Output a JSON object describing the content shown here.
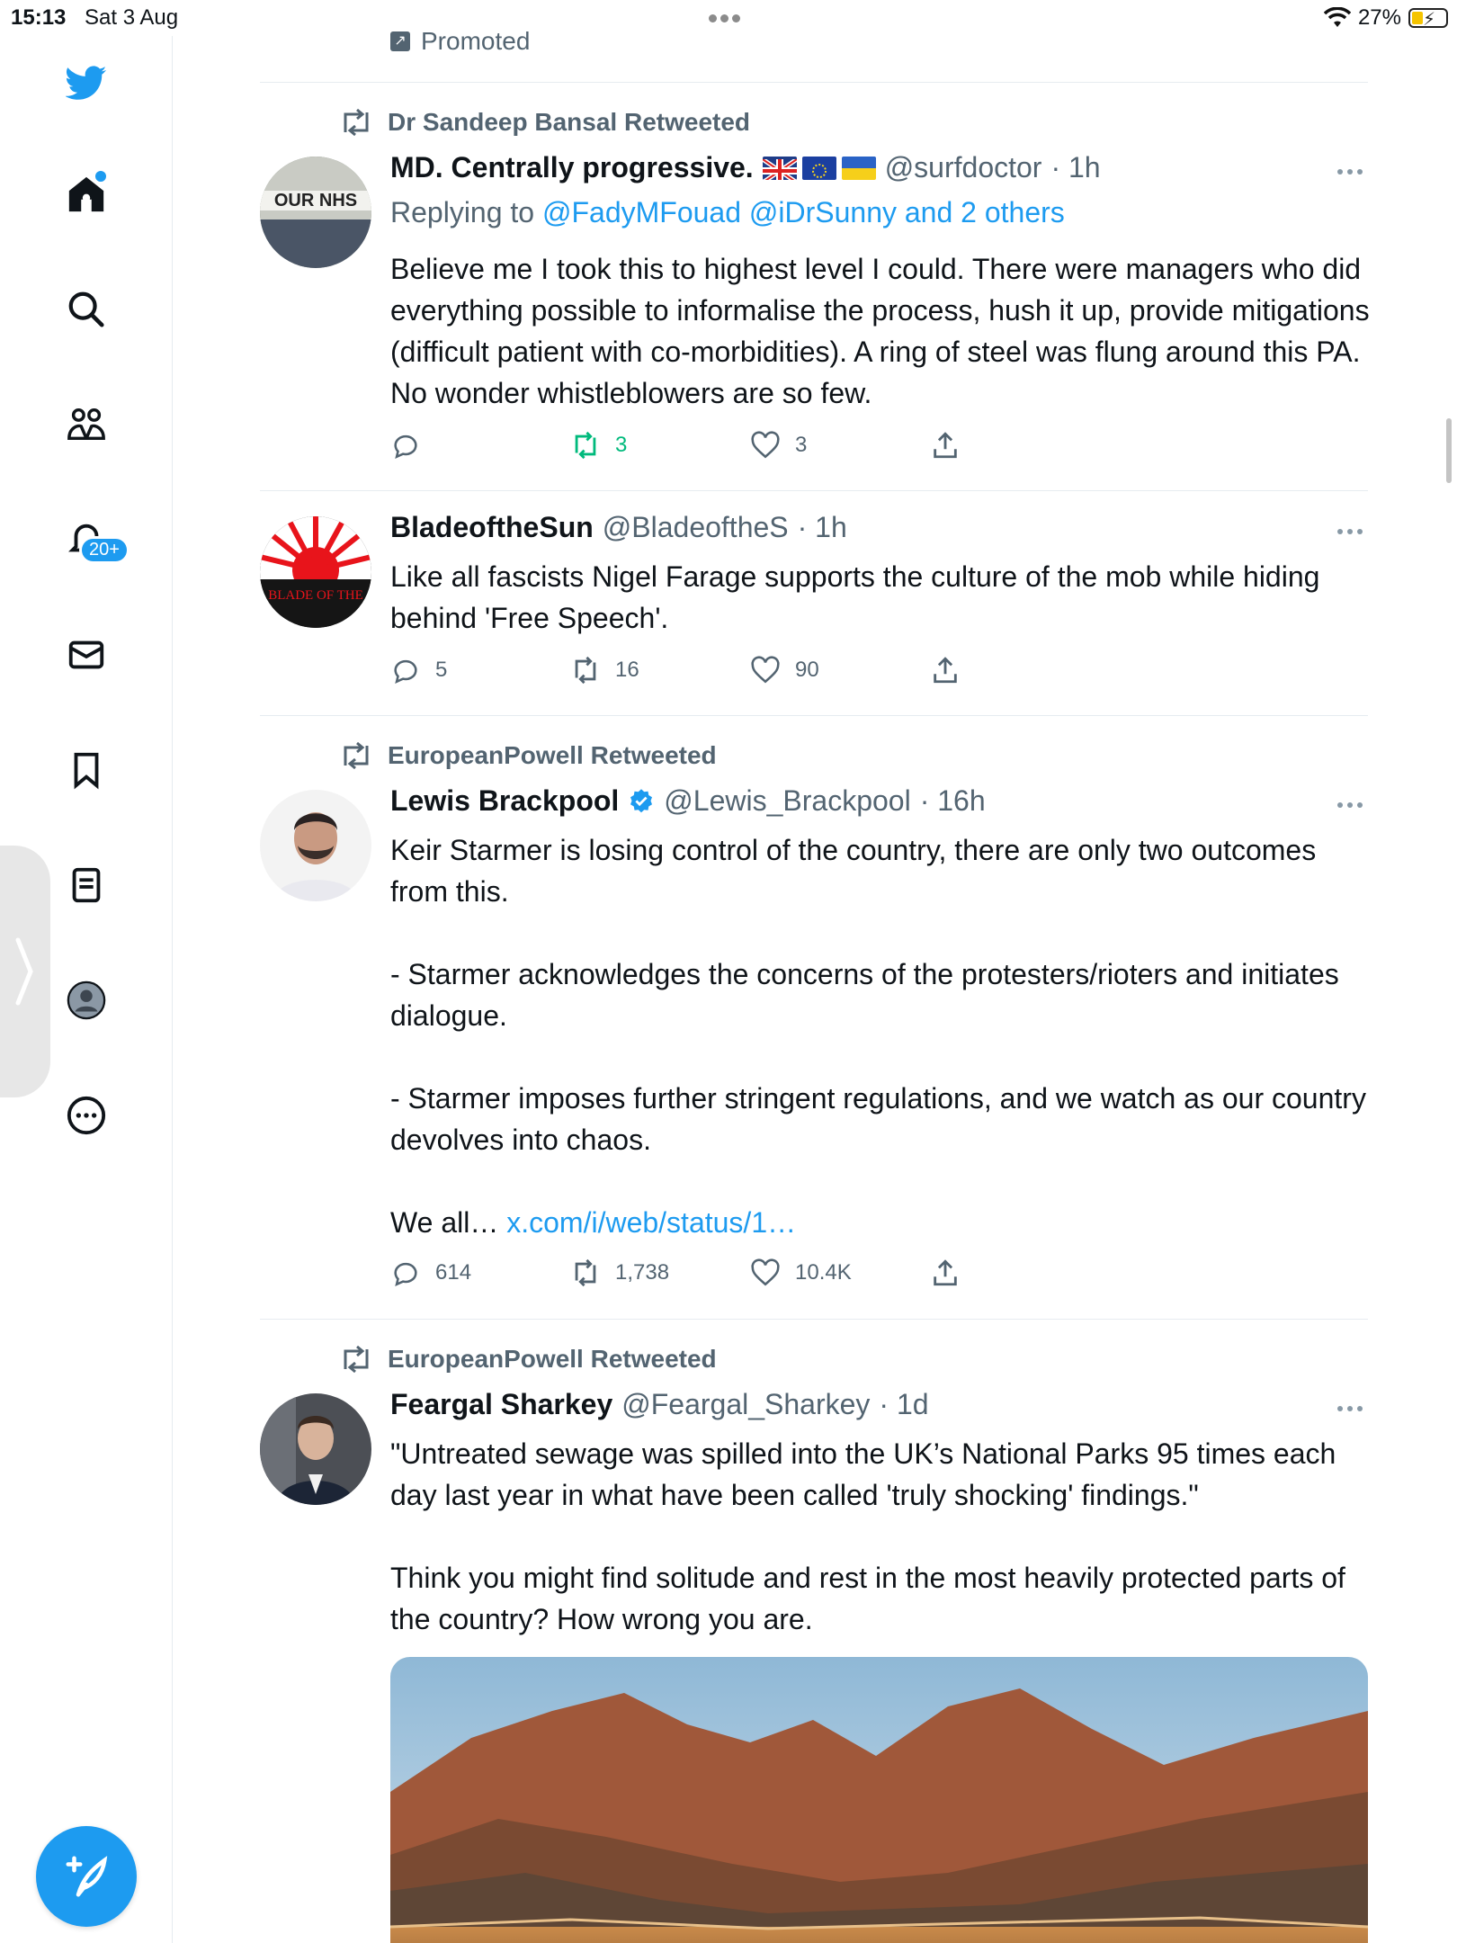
{
  "status": {
    "time": "15:13",
    "date": "Sat 3 Aug",
    "battery": "27%"
  },
  "sidebar": {
    "notifications_badge": "20+",
    "icons": [
      "twitter-bird-icon",
      "home-icon",
      "search-icon",
      "communities-icon",
      "notifications-icon",
      "messages-icon",
      "bookmarks-icon",
      "lists-icon",
      "profile-icon",
      "more-icon"
    ]
  },
  "promoted": {
    "label": "Promoted"
  },
  "tweets": [
    {
      "retweeted_by": "Dr Sandeep Bansal Retweeted",
      "name": "MD. Centrally progressive.",
      "handle": "@surfdoctor",
      "time": "· 1h",
      "reply_prefix": "Replying to ",
      "reply_links": "@FadyMFouad @iDrSunny and 2 others",
      "body": [
        "Believe me I took this to highest level I could. There were managers who did everything possible to informalise the process, hush it up, provide mitigations (difficult patient with co-morbidities). A ring of steel was flung around this PA. No wonder whistleblowers are so few."
      ],
      "avatar_text": "OUR NHS",
      "replies": "",
      "retweets": "3",
      "likes": "3"
    },
    {
      "name": "BladeoftheSun",
      "handle": "@BladeoftheS",
      "time": "· 1h",
      "body": [
        "Like all fascists Nigel Farage supports the culture of the mob while hiding behind 'Free Speech'."
      ],
      "avatar_text": "BLADE OF THE",
      "replies": "5",
      "retweets": "16",
      "likes": "90"
    },
    {
      "retweeted_by": "EuropeanPowell Retweeted",
      "name": "Lewis Brackpool",
      "handle": "@Lewis_Brackpool",
      "time": "· 16h",
      "body": [
        "Keir Starmer is losing control of the country, there are only two outcomes from this.",
        "",
        "- Starmer acknowledges the concerns of the protesters/rioters and initiates dialogue.",
        "",
        "- Starmer imposes further stringent regulations, and we watch as our country devolves into chaos.",
        ""
      ],
      "body_tail": "We all… ",
      "body_link": "x.com/i/web/status/1…",
      "replies": "614",
      "retweets": "1,738",
      "likes": "10.4K"
    },
    {
      "retweeted_by": "EuropeanPowell Retweeted",
      "name": "Feargal Sharkey",
      "handle": "@Feargal_Sharkey",
      "time": "· 1d",
      "body": [
        "\"Untreated sewage was spilled into the UK’s National Parks 95 times each day last year in what have been called 'truly shocking' findings.\"",
        "",
        "Think you might find solitude and rest in the most heavily protected parts of the country? How wrong you are."
      ]
    }
  ]
}
